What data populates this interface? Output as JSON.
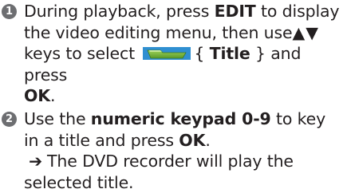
{
  "steps": [
    {
      "number": "1",
      "parts": {
        "a": "During playback, press ",
        "b_edit": "EDIT",
        "c": " to display the video editing menu, then use",
        "d_arrows": "▲▼",
        "e": " keys to select ",
        "f_open": "{ ",
        "g_title": "Title",
        "h_close": " }",
        "i": " and press ",
        "j_ok": "OK",
        "k": "."
      },
      "icon": "folder-tab-icon",
      "icon_colors": {
        "fill": "#7fb83e",
        "accent": "#2f8fd1"
      }
    },
    {
      "number": "2",
      "parts": {
        "a": "Use the ",
        "b_keypad": "numeric keypad 0-9",
        "c": " to key in a title and press ",
        "d_ok": "OK",
        "e": "."
      },
      "result_arrow": "➔",
      "result_text": "The DVD recorder will play the selected title."
    }
  ],
  "colors": {
    "text": "#231f20",
    "badge": "#6d6e71"
  }
}
